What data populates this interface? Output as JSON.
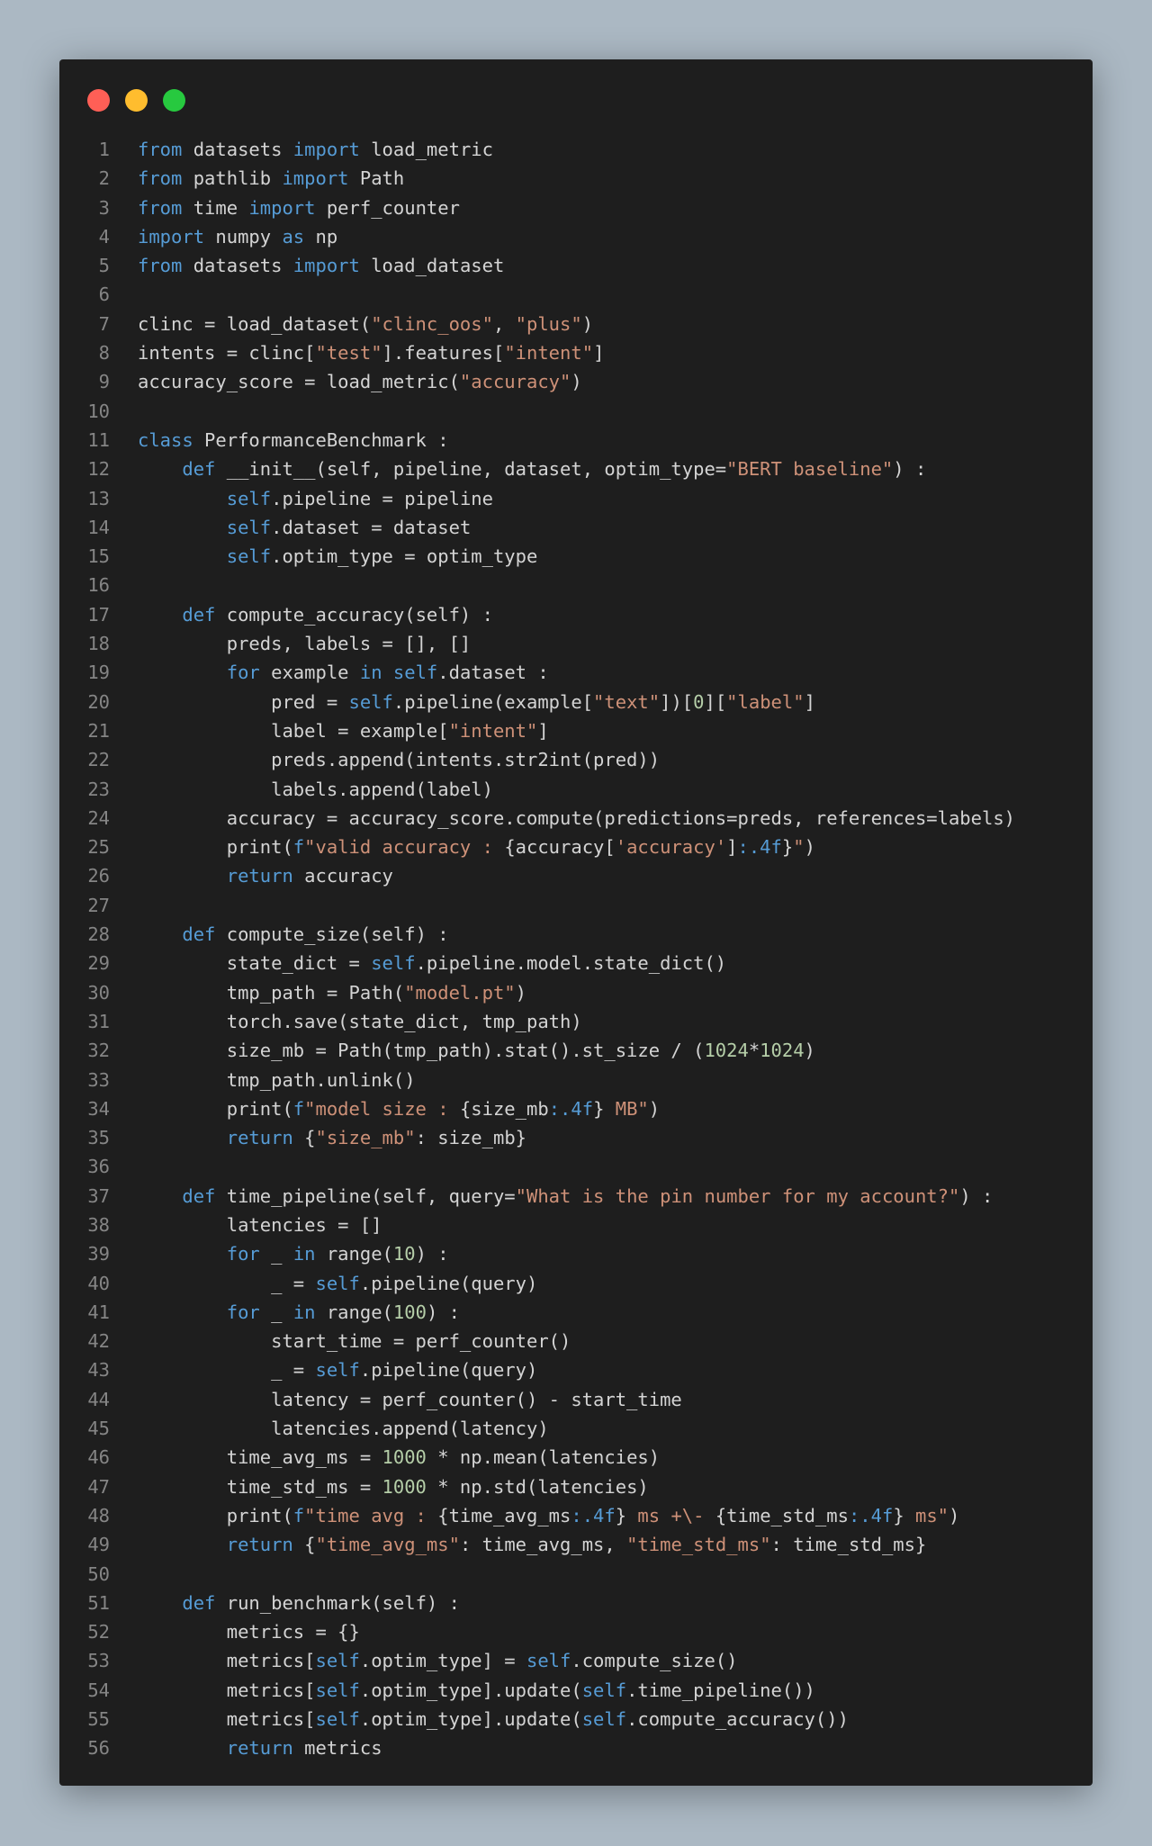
{
  "window": {
    "title_dots": [
      {
        "name": "close",
        "color": "#ff5f56"
      },
      {
        "name": "minimize",
        "color": "#ffbd2e"
      },
      {
        "name": "maximize",
        "color": "#27c93f"
      }
    ]
  },
  "theme": {
    "background": "#abb8c3",
    "editor_bg": "#1e1e1e",
    "text": "#d4d4d4",
    "keyword": "#569cd6",
    "string": "#ce9178",
    "number": "#b5cea8",
    "line_number": "#858585"
  },
  "code": {
    "lines": [
      {
        "n": "1",
        "tokens": [
          [
            "k",
            "from"
          ],
          [
            "t",
            " datasets "
          ],
          [
            "k",
            "import"
          ],
          [
            "t",
            " load_metric"
          ]
        ]
      },
      {
        "n": "2",
        "tokens": [
          [
            "k",
            "from"
          ],
          [
            "t",
            " pathlib "
          ],
          [
            "k",
            "import"
          ],
          [
            "t",
            " Path"
          ]
        ]
      },
      {
        "n": "3",
        "tokens": [
          [
            "k",
            "from"
          ],
          [
            "t",
            " time "
          ],
          [
            "k",
            "import"
          ],
          [
            "t",
            " perf_counter"
          ]
        ]
      },
      {
        "n": "4",
        "tokens": [
          [
            "k",
            "import"
          ],
          [
            "t",
            " numpy "
          ],
          [
            "k",
            "as"
          ],
          [
            "t",
            " np"
          ]
        ]
      },
      {
        "n": "5",
        "tokens": [
          [
            "k",
            "from"
          ],
          [
            "t",
            " datasets "
          ],
          [
            "k",
            "import"
          ],
          [
            "t",
            " load_dataset"
          ]
        ]
      },
      {
        "n": "6",
        "tokens": []
      },
      {
        "n": "7",
        "tokens": [
          [
            "t",
            "clinc = load_dataset("
          ],
          [
            "s",
            "\"clinc_oos\""
          ],
          [
            "t",
            ", "
          ],
          [
            "s",
            "\"plus\""
          ],
          [
            "t",
            ")"
          ]
        ]
      },
      {
        "n": "8",
        "tokens": [
          [
            "t",
            "intents = clinc["
          ],
          [
            "s",
            "\"test\""
          ],
          [
            "t",
            "].features["
          ],
          [
            "s",
            "\"intent\""
          ],
          [
            "t",
            "]"
          ]
        ]
      },
      {
        "n": "9",
        "tokens": [
          [
            "t",
            "accuracy_score = load_metric("
          ],
          [
            "s",
            "\"accuracy\""
          ],
          [
            "t",
            ")"
          ]
        ]
      },
      {
        "n": "10",
        "tokens": []
      },
      {
        "n": "11",
        "tokens": [
          [
            "k",
            "class"
          ],
          [
            "t",
            " PerformanceBenchmark :"
          ]
        ]
      },
      {
        "n": "12",
        "tokens": [
          [
            "t",
            "    "
          ],
          [
            "k",
            "def"
          ],
          [
            "t",
            " __init__(self, pipeline, dataset, optim_type="
          ],
          [
            "s",
            "\"BERT baseline\""
          ],
          [
            "t",
            ") :"
          ]
        ]
      },
      {
        "n": "13",
        "tokens": [
          [
            "t",
            "        "
          ],
          [
            "k",
            "self"
          ],
          [
            "t",
            ".pipeline = pipeline"
          ]
        ]
      },
      {
        "n": "14",
        "tokens": [
          [
            "t",
            "        "
          ],
          [
            "k",
            "self"
          ],
          [
            "t",
            ".dataset = dataset"
          ]
        ]
      },
      {
        "n": "15",
        "tokens": [
          [
            "t",
            "        "
          ],
          [
            "k",
            "self"
          ],
          [
            "t",
            ".optim_type = optim_type"
          ]
        ]
      },
      {
        "n": "16",
        "tokens": []
      },
      {
        "n": "17",
        "tokens": [
          [
            "t",
            "    "
          ],
          [
            "k",
            "def"
          ],
          [
            "t",
            " compute_accuracy(self) :"
          ]
        ]
      },
      {
        "n": "18",
        "tokens": [
          [
            "t",
            "        preds, labels = [], []"
          ]
        ]
      },
      {
        "n": "19",
        "tokens": [
          [
            "t",
            "        "
          ],
          [
            "k",
            "for"
          ],
          [
            "t",
            " example "
          ],
          [
            "k",
            "in"
          ],
          [
            "t",
            " "
          ],
          [
            "k",
            "self"
          ],
          [
            "t",
            ".dataset :"
          ]
        ]
      },
      {
        "n": "20",
        "tokens": [
          [
            "t",
            "            pred = "
          ],
          [
            "k",
            "self"
          ],
          [
            "t",
            ".pipeline(example["
          ],
          [
            "s",
            "\"text\""
          ],
          [
            "t",
            "])["
          ],
          [
            "n",
            "0"
          ],
          [
            "t",
            "]["
          ],
          [
            "s",
            "\"label\""
          ],
          [
            "t",
            "]"
          ]
        ]
      },
      {
        "n": "21",
        "tokens": [
          [
            "t",
            "            label = example["
          ],
          [
            "s",
            "\"intent\""
          ],
          [
            "t",
            "]"
          ]
        ]
      },
      {
        "n": "22",
        "tokens": [
          [
            "t",
            "            preds.append(intents.str2int(pred))"
          ]
        ]
      },
      {
        "n": "23",
        "tokens": [
          [
            "t",
            "            labels.append(label)"
          ]
        ]
      },
      {
        "n": "24",
        "tokens": [
          [
            "t",
            "        accuracy = accuracy_score.compute(predictions=preds, references=labels)"
          ]
        ]
      },
      {
        "n": "25",
        "tokens": [
          [
            "t",
            "        print("
          ],
          [
            "k",
            "f"
          ],
          [
            "s",
            "\"valid accuracy : "
          ],
          [
            "t",
            "{accuracy["
          ],
          [
            "s",
            "'accuracy'"
          ],
          [
            "t",
            "]"
          ],
          [
            "k",
            ":.4f"
          ],
          [
            "t",
            "}"
          ],
          [
            "s",
            "\""
          ],
          [
            "t",
            ")"
          ]
        ]
      },
      {
        "n": "26",
        "tokens": [
          [
            "t",
            "        "
          ],
          [
            "k",
            "return"
          ],
          [
            "t",
            " accuracy"
          ]
        ]
      },
      {
        "n": "27",
        "tokens": []
      },
      {
        "n": "28",
        "tokens": [
          [
            "t",
            "    "
          ],
          [
            "k",
            "def"
          ],
          [
            "t",
            " compute_size(self) :"
          ]
        ]
      },
      {
        "n": "29",
        "tokens": [
          [
            "t",
            "        state_dict = "
          ],
          [
            "k",
            "self"
          ],
          [
            "t",
            ".pipeline.model.state_dict()"
          ]
        ]
      },
      {
        "n": "30",
        "tokens": [
          [
            "t",
            "        tmp_path = Path("
          ],
          [
            "s",
            "\"model.pt\""
          ],
          [
            "t",
            ")"
          ]
        ]
      },
      {
        "n": "31",
        "tokens": [
          [
            "t",
            "        torch.save(state_dict, tmp_path)"
          ]
        ]
      },
      {
        "n": "32",
        "tokens": [
          [
            "t",
            "        size_mb = Path(tmp_path).stat().st_size / ("
          ],
          [
            "n",
            "1024"
          ],
          [
            "t",
            "*"
          ],
          [
            "n",
            "1024"
          ],
          [
            "t",
            ")"
          ]
        ]
      },
      {
        "n": "33",
        "tokens": [
          [
            "t",
            "        tmp_path.unlink()"
          ]
        ]
      },
      {
        "n": "34",
        "tokens": [
          [
            "t",
            "        print("
          ],
          [
            "k",
            "f"
          ],
          [
            "s",
            "\"model size : "
          ],
          [
            "t",
            "{size_mb"
          ],
          [
            "k",
            ":.4f"
          ],
          [
            "t",
            "}"
          ],
          [
            "s",
            " MB\""
          ],
          [
            "t",
            ")"
          ]
        ]
      },
      {
        "n": "35",
        "tokens": [
          [
            "t",
            "        "
          ],
          [
            "k",
            "return"
          ],
          [
            "t",
            " {"
          ],
          [
            "s",
            "\"size_mb\""
          ],
          [
            "t",
            ": size_mb}"
          ]
        ]
      },
      {
        "n": "36",
        "tokens": []
      },
      {
        "n": "37",
        "tokens": [
          [
            "t",
            "    "
          ],
          [
            "k",
            "def"
          ],
          [
            "t",
            " time_pipeline(self, query="
          ],
          [
            "s",
            "\"What is the pin number for my account?\""
          ],
          [
            "t",
            ") :"
          ]
        ]
      },
      {
        "n": "38",
        "tokens": [
          [
            "t",
            "        latencies = []"
          ]
        ]
      },
      {
        "n": "39",
        "tokens": [
          [
            "t",
            "        "
          ],
          [
            "k",
            "for"
          ],
          [
            "t",
            " _ "
          ],
          [
            "k",
            "in"
          ],
          [
            "t",
            " range("
          ],
          [
            "n",
            "10"
          ],
          [
            "t",
            ") :"
          ]
        ]
      },
      {
        "n": "40",
        "tokens": [
          [
            "t",
            "            _ = "
          ],
          [
            "k",
            "self"
          ],
          [
            "t",
            ".pipeline(query)"
          ]
        ]
      },
      {
        "n": "41",
        "tokens": [
          [
            "t",
            "        "
          ],
          [
            "k",
            "for"
          ],
          [
            "t",
            " _ "
          ],
          [
            "k",
            "in"
          ],
          [
            "t",
            " range("
          ],
          [
            "n",
            "100"
          ],
          [
            "t",
            ") :"
          ]
        ]
      },
      {
        "n": "42",
        "tokens": [
          [
            "t",
            "            start_time = perf_counter()"
          ]
        ]
      },
      {
        "n": "43",
        "tokens": [
          [
            "t",
            "            _ = "
          ],
          [
            "k",
            "self"
          ],
          [
            "t",
            ".pipeline(query)"
          ]
        ]
      },
      {
        "n": "44",
        "tokens": [
          [
            "t",
            "            latency = perf_counter() - start_time"
          ]
        ]
      },
      {
        "n": "45",
        "tokens": [
          [
            "t",
            "            latencies.append(latency)"
          ]
        ]
      },
      {
        "n": "46",
        "tokens": [
          [
            "t",
            "        time_avg_ms = "
          ],
          [
            "n",
            "1000"
          ],
          [
            "t",
            " * np.mean(latencies)"
          ]
        ]
      },
      {
        "n": "47",
        "tokens": [
          [
            "t",
            "        time_std_ms = "
          ],
          [
            "n",
            "1000"
          ],
          [
            "t",
            " * np.std(latencies)"
          ]
        ]
      },
      {
        "n": "48",
        "tokens": [
          [
            "t",
            "        print("
          ],
          [
            "k",
            "f"
          ],
          [
            "s",
            "\"time avg : "
          ],
          [
            "t",
            "{time_avg_ms"
          ],
          [
            "k",
            ":.4f"
          ],
          [
            "t",
            "}"
          ],
          [
            "s",
            " ms +\\- "
          ],
          [
            "t",
            "{time_std_ms"
          ],
          [
            "k",
            ":.4f"
          ],
          [
            "t",
            "}"
          ],
          [
            "s",
            " ms\""
          ],
          [
            "t",
            ")"
          ]
        ]
      },
      {
        "n": "49",
        "tokens": [
          [
            "t",
            "        "
          ],
          [
            "k",
            "return"
          ],
          [
            "t",
            " {"
          ],
          [
            "s",
            "\"time_avg_ms\""
          ],
          [
            "t",
            ": time_avg_ms, "
          ],
          [
            "s",
            "\"time_std_ms\""
          ],
          [
            "t",
            ": time_std_ms}"
          ]
        ]
      },
      {
        "n": "50",
        "tokens": []
      },
      {
        "n": "51",
        "tokens": [
          [
            "t",
            "    "
          ],
          [
            "k",
            "def"
          ],
          [
            "t",
            " run_benchmark(self) :"
          ]
        ]
      },
      {
        "n": "52",
        "tokens": [
          [
            "t",
            "        metrics = {}"
          ]
        ]
      },
      {
        "n": "53",
        "tokens": [
          [
            "t",
            "        metrics["
          ],
          [
            "k",
            "self"
          ],
          [
            "t",
            ".optim_type] = "
          ],
          [
            "k",
            "self"
          ],
          [
            "t",
            ".compute_size()"
          ]
        ]
      },
      {
        "n": "54",
        "tokens": [
          [
            "t",
            "        metrics["
          ],
          [
            "k",
            "self"
          ],
          [
            "t",
            ".optim_type].update("
          ],
          [
            "k",
            "self"
          ],
          [
            "t",
            ".time_pipeline())"
          ]
        ]
      },
      {
        "n": "55",
        "tokens": [
          [
            "t",
            "        metrics["
          ],
          [
            "k",
            "self"
          ],
          [
            "t",
            ".optim_type].update("
          ],
          [
            "k",
            "self"
          ],
          [
            "t",
            ".compute_accuracy())"
          ]
        ]
      },
      {
        "n": "56",
        "tokens": [
          [
            "t",
            "        "
          ],
          [
            "k",
            "return"
          ],
          [
            "t",
            " metrics"
          ]
        ]
      }
    ]
  }
}
